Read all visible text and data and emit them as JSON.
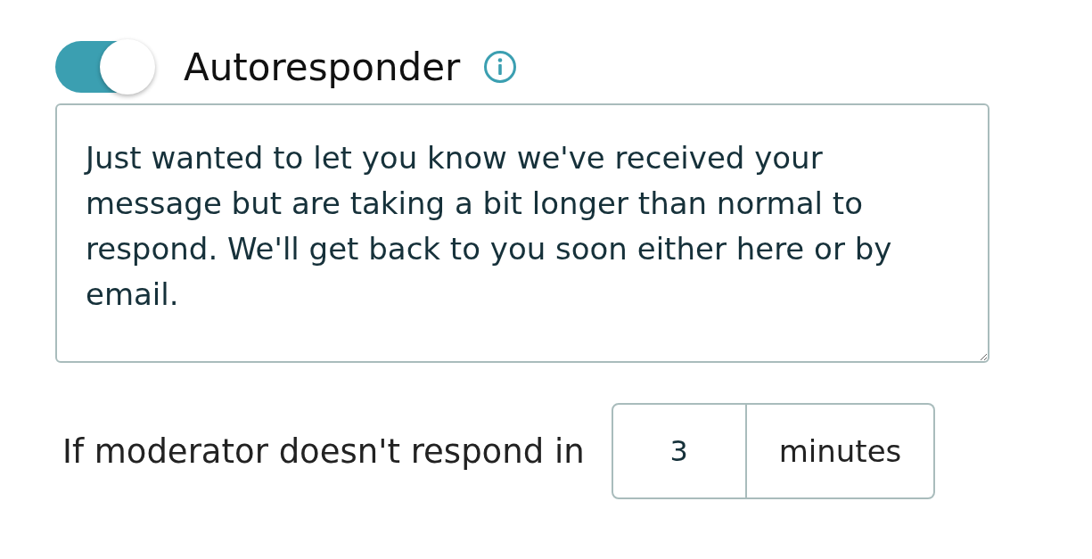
{
  "autoresponder": {
    "label": "Autoresponder",
    "on": true,
    "message": "Just wanted to let you know we've received your message but are taking a bit longer than normal to respond. We'll get back to you soon either here or by email."
  },
  "delay": {
    "label": "If moderator doesn't respond in",
    "value": "3",
    "unit": "minutes"
  }
}
